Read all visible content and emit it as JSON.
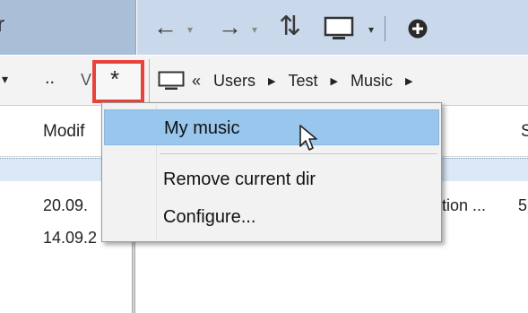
{
  "title_fragment": "r",
  "toolbar": {
    "back_glyph": "←",
    "forward_glyph": "→",
    "caret_glyph": "▾",
    "refresh_glyph": "⇅",
    "add_glyph": "⊕"
  },
  "path_row": {
    "dropdown_glyph": "▾",
    "parent_label": "..",
    "hidden_letter": "V",
    "favorites_glyph": "*",
    "overflow_glyph": "«",
    "crumb_arrow": "▶",
    "breadcrumbs": [
      "Users",
      "Test",
      "Music"
    ]
  },
  "columns": {
    "modified_header": "Modif",
    "right_partial_header": "S"
  },
  "rows": [
    {
      "date": "20.09.",
      "desc": "tion ...",
      "size": "5"
    },
    {
      "date": "14.09.2"
    }
  ],
  "menu": {
    "items": [
      "My music",
      "Remove current dir",
      "Configure..."
    ]
  },
  "colors": {
    "highlight": "#e8433b",
    "menu_hover": "#99c6ec",
    "title_bar": "#a9bfd8"
  }
}
